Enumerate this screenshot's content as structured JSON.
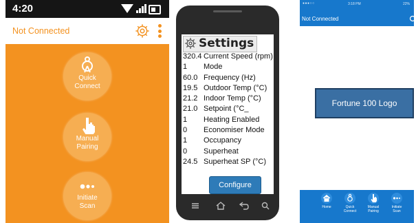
{
  "screen1": {
    "status_time": "4:20",
    "connection_status": "Not Connected",
    "buttons": [
      {
        "line1": "Quick",
        "line2": "Connect",
        "icon": "quick-connect-icon"
      },
      {
        "line1": "Manual",
        "line2": "Pairing",
        "icon": "hand-pointer-icon"
      },
      {
        "line1": "Initiate",
        "line2": "Scan",
        "icon": "scan-dots-icon"
      }
    ],
    "colors": {
      "accent": "#f39220",
      "button": "#f6ae52",
      "status_bar": "#151515"
    }
  },
  "screen2": {
    "title": "Settings",
    "rows": [
      {
        "value": "320.4",
        "label": "Current Speed (rpm)"
      },
      {
        "value": "1",
        "label": "Mode"
      },
      {
        "value": "60.0",
        "label": "Frequency (Hz)"
      },
      {
        "value": "19.5",
        "label": "Outdoor Temp (°C)"
      },
      {
        "value": "21.2",
        "label": "Indoor Temp (°C)"
      },
      {
        "value": "21.0",
        "label": "Setpoint (°C_"
      },
      {
        "value": "1",
        "label": "Heating Enabled"
      },
      {
        "value": "0",
        "label": "Economiser Mode"
      },
      {
        "value": "1",
        "label": "Occupancy"
      },
      {
        "value": "0",
        "label": "Superheat"
      },
      {
        "value": "24.5",
        "label": "Superheat SP (°C)"
      }
    ],
    "configure_label": "Configure",
    "colors": {
      "button": "#2e7bb8",
      "phone_body": "#2a2a2a"
    }
  },
  "screen3": {
    "status_time": "3:18 PM",
    "status_battery": "22%",
    "connection_status": "Not Connected",
    "logo_text": "Fortune 100 Logo",
    "tabs": [
      {
        "line1": "Home",
        "line2": "",
        "icon": "home-icon"
      },
      {
        "line1": "Quick",
        "line2": "Connect",
        "icon": "quick-connect-icon"
      },
      {
        "line1": "Manual",
        "line2": "Pairing",
        "icon": "hand-pointer-icon"
      },
      {
        "line1": "Initiate",
        "line2": "Scan",
        "icon": "scan-dots-icon"
      }
    ],
    "colors": {
      "primary": "#1778cc",
      "logo_button": "#3a6fa3"
    }
  }
}
